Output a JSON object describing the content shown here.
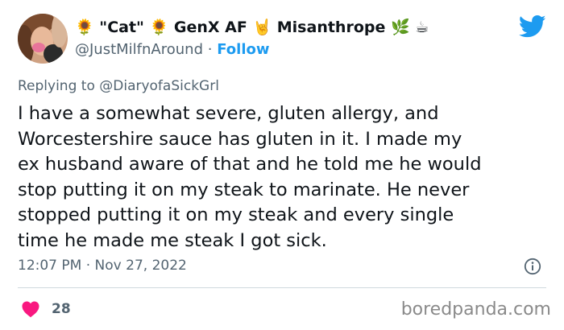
{
  "user": {
    "display_name_parts": [
      "🌻",
      "\"Cat\"",
      "🌻",
      "GenX AF",
      "🤘",
      "Misanthrope",
      "🌿",
      "☕"
    ],
    "handle": "@JustMilfnAround",
    "separator": "·",
    "follow_label": "Follow"
  },
  "reply": {
    "prefix": "Replying to",
    "mention": "@DiaryofaSickGrl"
  },
  "tweet": {
    "text": "I have a somewhat severe, gluten allergy, and\nWorcestershire sauce has gluten in it. I made my\nex husband aware of that and he told me he would\nstop putting it on my steak to marinate. He never\nstopped putting it on my steak and every single\ntime he made me steak I got sick.",
    "time": "12:07 PM",
    "separator": "·",
    "date": "Nov 27, 2022"
  },
  "engagement": {
    "likes": "28"
  },
  "watermark": "boredpanda.com",
  "colors": {
    "accent": "#1d9bf0",
    "like": "#f91880",
    "muted": "#536471",
    "text": "#0f1419"
  },
  "icons": [
    "twitter-bird-icon",
    "info-icon",
    "heart-icon"
  ]
}
